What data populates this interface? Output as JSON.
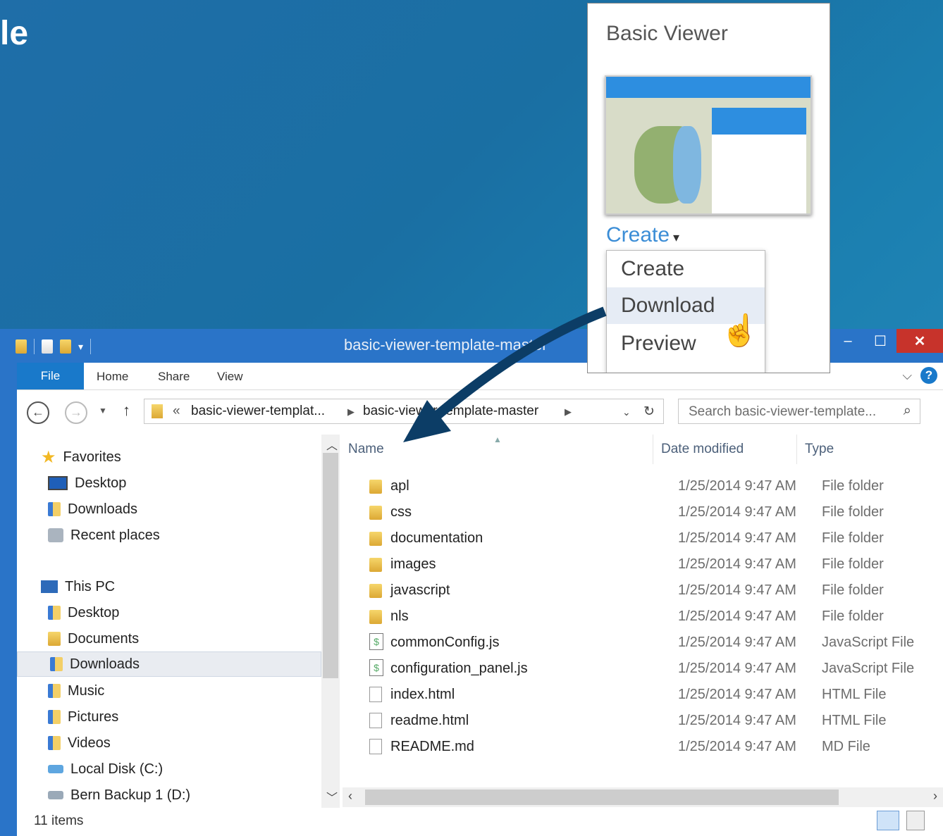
{
  "slide": {
    "title_fragment": "le"
  },
  "window": {
    "title": "basic-viewer-template-master"
  },
  "ribbon": {
    "tabs": [
      "File",
      "Home",
      "Share",
      "View"
    ]
  },
  "address": {
    "parent": "basic-viewer-templat...",
    "current": "basic-viewer-template-master",
    "search_placeholder": "Search basic-viewer-template..."
  },
  "navpane": {
    "favorites_label": "Favorites",
    "favorites": [
      "Desktop",
      "Downloads",
      "Recent places"
    ],
    "thispc_label": "This PC",
    "thispc": [
      "Desktop",
      "Documents",
      "Downloads",
      "Music",
      "Pictures",
      "Videos",
      "Local Disk (C:)",
      "Bern Backup 1 (D:)"
    ],
    "selected": "Downloads"
  },
  "columns": {
    "name": "Name",
    "date": "Date modified",
    "type": "Type"
  },
  "files": [
    {
      "name": "apl",
      "date": "1/25/2014 9:47 AM",
      "type": "File folder",
      "icon": "folder-icon"
    },
    {
      "name": "css",
      "date": "1/25/2014 9:47 AM",
      "type": "File folder",
      "icon": "folder-icon"
    },
    {
      "name": "documentation",
      "date": "1/25/2014 9:47 AM",
      "type": "File folder",
      "icon": "folder-icon"
    },
    {
      "name": "images",
      "date": "1/25/2014 9:47 AM",
      "type": "File folder",
      "icon": "folder-icon"
    },
    {
      "name": "javascript",
      "date": "1/25/2014 9:47 AM",
      "type": "File folder",
      "icon": "folder-icon"
    },
    {
      "name": "nls",
      "date": "1/25/2014 9:47 AM",
      "type": "File folder",
      "icon": "folder-icon"
    },
    {
      "name": "commonConfig.js",
      "date": "1/25/2014 9:47 AM",
      "type": "JavaScript File",
      "icon": "js-file-icon"
    },
    {
      "name": "configuration_panel.js",
      "date": "1/25/2014 9:47 AM",
      "type": "JavaScript File",
      "icon": "js-file-icon"
    },
    {
      "name": "index.html",
      "date": "1/25/2014 9:47 AM",
      "type": "HTML File",
      "icon": "html-file-icon"
    },
    {
      "name": "readme.html",
      "date": "1/25/2014 9:47 AM",
      "type": "HTML File",
      "icon": "html-file-icon"
    },
    {
      "name": "README.md",
      "date": "1/25/2014 9:47 AM",
      "type": "MD File",
      "icon": "md-file-icon"
    }
  ],
  "status": {
    "items_count": "11 items"
  },
  "popup": {
    "title": "Basic Viewer",
    "create_link": "Create",
    "menu": [
      "Create",
      "Download",
      "Preview"
    ],
    "highlighted": "Download"
  },
  "colors": {
    "accent": "#1979ca",
    "title_bar": "#2a74c8",
    "close": "#c7332b",
    "arrow": "#0c3d66"
  }
}
